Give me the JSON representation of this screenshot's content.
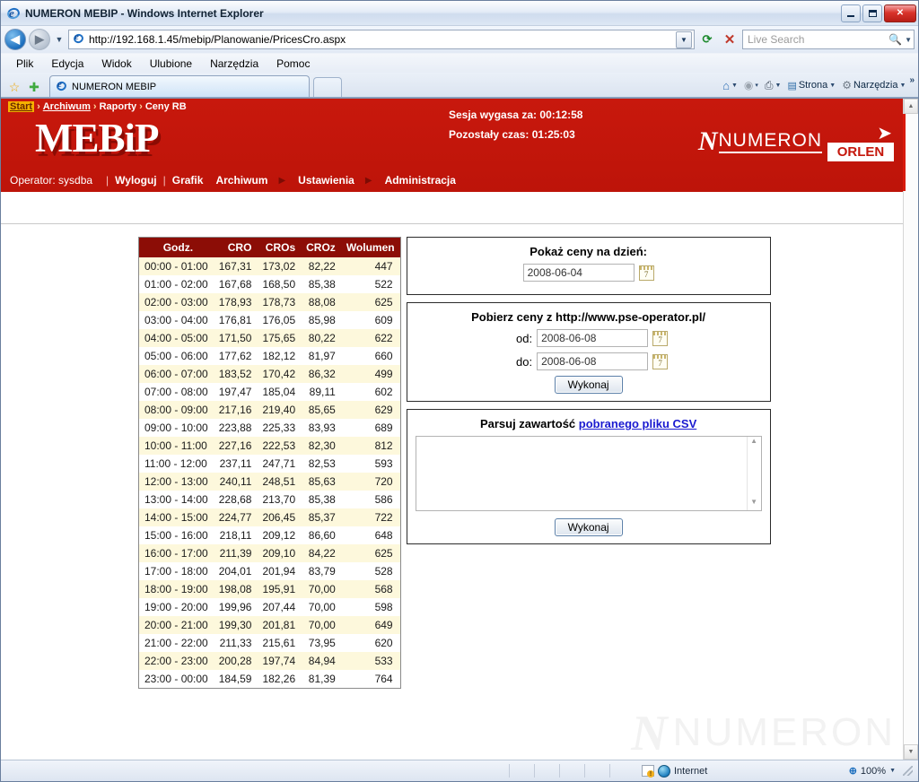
{
  "window": {
    "title": "NUMERON MEBIP - Windows Internet Explorer",
    "minimize_label": "Minimize",
    "maximize_label": "Maximize",
    "close_label": "✕"
  },
  "browser": {
    "back_label": "◀",
    "forward_label": "▶",
    "history_caret": "▼",
    "url": "http://192.168.1.45/mebip/Planowanie/PricesCro.aspx",
    "url_dropdown_caret": "▼",
    "refresh_icon": "⟳",
    "stop_icon": "✕",
    "search_placeholder": "Live Search",
    "search_icon": "🔍",
    "search_caret": "▼",
    "menu": [
      {
        "label": "Plik"
      },
      {
        "label": "Edycja"
      },
      {
        "label": "Widok"
      },
      {
        "label": "Ulubione"
      },
      {
        "label": "Narzędzia"
      },
      {
        "label": "Pomoc"
      }
    ],
    "tab": {
      "label": "NUMERON MEBIP"
    },
    "favorites_add": "☆",
    "favorites_center": "✚",
    "commands": [
      {
        "label": "",
        "icon": "home-icon",
        "glyph": "⌂",
        "caret": "▼"
      },
      {
        "label": "",
        "icon": "feeds-icon",
        "glyph": "◉",
        "caret": "▾"
      },
      {
        "label": "",
        "icon": "print-icon",
        "glyph": "⎙",
        "caret": "▼"
      },
      {
        "label": "Strona",
        "icon": "page-icon",
        "glyph": "▤",
        "caret": "▼"
      },
      {
        "label": "Narzędzia",
        "icon": "tools-icon",
        "glyph": "⚙",
        "caret": "▼"
      }
    ],
    "overflow_chevron": "»"
  },
  "statusbar": {
    "zone_label": "Internet",
    "zoom_label": "100%",
    "zoom_icon": "⊕",
    "zoom_caret": "▼"
  },
  "page": {
    "breadcrumb": {
      "start": "Start",
      "sep": "›",
      "items": [
        "Archiwum",
        "Raporty",
        "Ceny RB"
      ]
    },
    "logo": "MEBiP",
    "session": {
      "expires_label": "Sesja wygasa za:",
      "expires_value": "00:12:58",
      "remaining_label": "Pozostały czas:",
      "remaining_value": "01:25:03"
    },
    "brands": {
      "numeron": "NUMERON",
      "numeron_mark": "N",
      "orlen": "ORLEN",
      "orlen_eagle": "➤"
    },
    "nav": {
      "operator": "Operator: sysdba",
      "separator": "|",
      "logout": "Wyloguj",
      "items": [
        "Grafik",
        "Archiwum",
        "Ustawienia",
        "Administracja"
      ],
      "arrow": "▶"
    },
    "watermark": {
      "mark": "N",
      "word": "NUMERON"
    }
  },
  "table": {
    "columns": [
      "Godz.",
      "CRO",
      "CROs",
      "CROz",
      "Wolumen"
    ],
    "rows": [
      [
        "00:00 - 01:00",
        "167,31",
        "173,02",
        "82,22",
        "447"
      ],
      [
        "01:00 - 02:00",
        "167,68",
        "168,50",
        "85,38",
        "522"
      ],
      [
        "02:00 - 03:00",
        "178,93",
        "178,73",
        "88,08",
        "625"
      ],
      [
        "03:00 - 04:00",
        "176,81",
        "176,05",
        "85,98",
        "609"
      ],
      [
        "04:00 - 05:00",
        "171,50",
        "175,65",
        "80,22",
        "622"
      ],
      [
        "05:00 - 06:00",
        "177,62",
        "182,12",
        "81,97",
        "660"
      ],
      [
        "06:00 - 07:00",
        "183,52",
        "170,42",
        "86,32",
        "499"
      ],
      [
        "07:00 - 08:00",
        "197,47",
        "185,04",
        "89,11",
        "602"
      ],
      [
        "08:00 - 09:00",
        "217,16",
        "219,40",
        "85,65",
        "629"
      ],
      [
        "09:00 - 10:00",
        "223,88",
        "225,33",
        "83,93",
        "689"
      ],
      [
        "10:00 - 11:00",
        "227,16",
        "222,53",
        "82,30",
        "812"
      ],
      [
        "11:00 - 12:00",
        "237,11",
        "247,71",
        "82,53",
        "593"
      ],
      [
        "12:00 - 13:00",
        "240,11",
        "248,51",
        "85,63",
        "720"
      ],
      [
        "13:00 - 14:00",
        "228,68",
        "213,70",
        "85,38",
        "586"
      ],
      [
        "14:00 - 15:00",
        "224,77",
        "206,45",
        "85,37",
        "722"
      ],
      [
        "15:00 - 16:00",
        "218,11",
        "209,12",
        "86,60",
        "648"
      ],
      [
        "16:00 - 17:00",
        "211,39",
        "209,10",
        "84,22",
        "625"
      ],
      [
        "17:00 - 18:00",
        "204,01",
        "201,94",
        "83,79",
        "528"
      ],
      [
        "18:00 - 19:00",
        "198,08",
        "195,91",
        "70,00",
        "568"
      ],
      [
        "19:00 - 20:00",
        "199,96",
        "207,44",
        "70,00",
        "598"
      ],
      [
        "20:00 - 21:00",
        "199,30",
        "201,81",
        "70,00",
        "649"
      ],
      [
        "21:00 - 22:00",
        "211,33",
        "215,61",
        "73,95",
        "620"
      ],
      [
        "22:00 - 23:00",
        "200,28",
        "197,74",
        "84,94",
        "533"
      ],
      [
        "23:00 - 00:00",
        "184,59",
        "182,26",
        "81,39",
        "764"
      ]
    ]
  },
  "panels": {
    "show_prices": {
      "title": "Pokaż ceny na dzień:",
      "date_value": "2008-06-04",
      "calendar_day": "7"
    },
    "download_prices": {
      "title": "Pobierz ceny z http://www.pse-operator.pl/",
      "from_label": "od:",
      "from_value": "2008-06-08",
      "to_label": "do:",
      "to_value": "2008-06-08",
      "calendar_day": "7",
      "submit_label": "Wykonaj"
    },
    "parse_csv": {
      "title_prefix": "Parsuj zawartość",
      "title_link": "pobranego pliku CSV",
      "textarea_value": "",
      "scroll_up": "▲",
      "scroll_down": "▼",
      "submit_label": "Wykonaj"
    }
  },
  "scrollbar": {
    "up": "▲",
    "down": "▼"
  }
}
